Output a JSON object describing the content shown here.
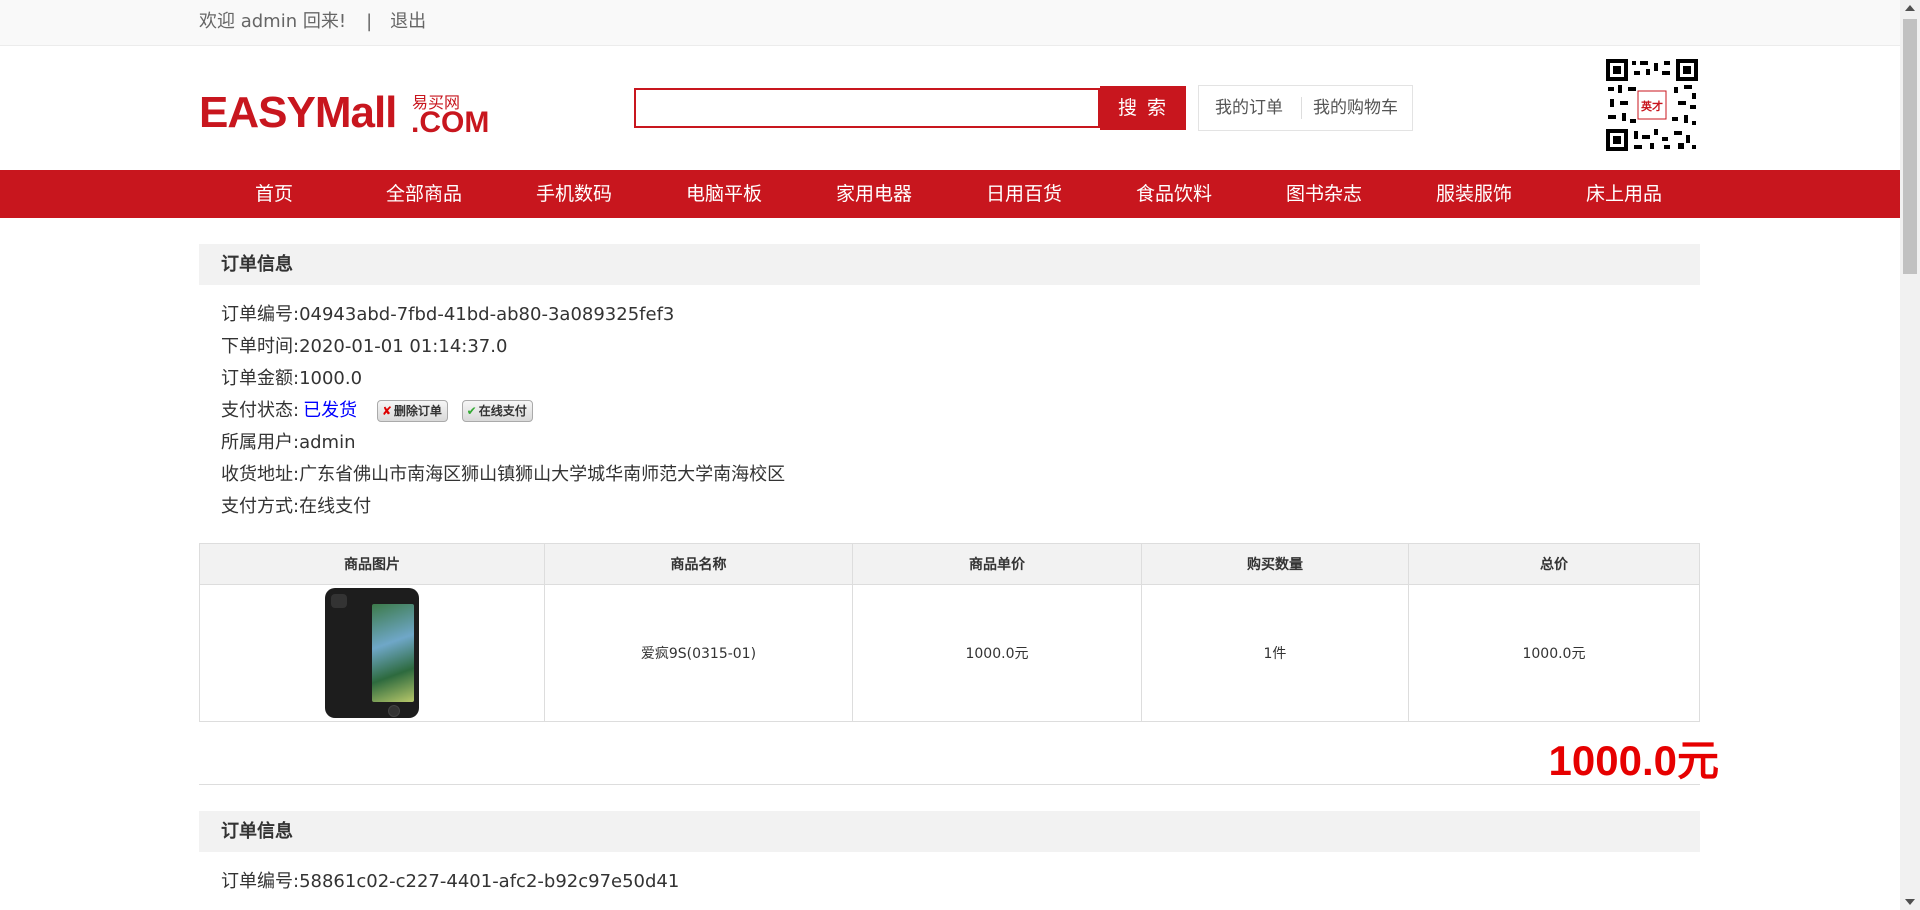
{
  "topbar": {
    "welcome": "欢迎 admin 回来!",
    "separator": "|",
    "logout": "退出"
  },
  "header": {
    "logo_main": "EASYMall",
    "logo_cn": "易买网",
    "logo_com": ".COM",
    "search_value": "",
    "search_button": "搜 索",
    "my_orders": "我的订单",
    "my_cart": "我的购物车",
    "qr_label": "英才"
  },
  "nav": [
    "首页",
    "全部商品",
    "手机数码",
    "电脑平板",
    "家用电器",
    "日用百货",
    "食品饮料",
    "图书杂志",
    "服装服饰",
    "床上用品"
  ],
  "orders": [
    {
      "section_title": "订单信息",
      "order_id_label": "订单编号:",
      "order_id": "04943abd-7fbd-41bd-ab80-3a089325fef3",
      "time_label": "下单时间:",
      "time": "2020-01-01 01:14:37.0",
      "amount_label": "订单金额:",
      "amount": "1000.0",
      "status_label": "支付状态:",
      "status": "已发货",
      "delete_btn": "删除订单",
      "pay_btn": "在线支付",
      "user_label": "所属用户:",
      "user": "admin",
      "address_label": "收货地址:",
      "address": "广东省佛山市南海区狮山镇狮山大学城华南师范大学南海校区",
      "pay_method_label": "支付方式:",
      "pay_method": "在线支付",
      "table_headers": [
        "商品图片",
        "商品名称",
        "商品单价",
        "购买数量",
        "总价"
      ],
      "items": [
        {
          "name": "爱疯9S(0315-01)",
          "price": "1000.0元",
          "qty": "1件",
          "total": "1000.0元"
        }
      ],
      "grand_total": "1000.0元"
    },
    {
      "section_title": "订单信息",
      "order_id_label": "订单编号:",
      "order_id": "58861c02-c227-4401-afc2-b92c97e50d41"
    }
  ],
  "colors": {
    "brand_red": "#c8161e",
    "total_red": "#e60000",
    "status_blue": "#0000ff"
  }
}
